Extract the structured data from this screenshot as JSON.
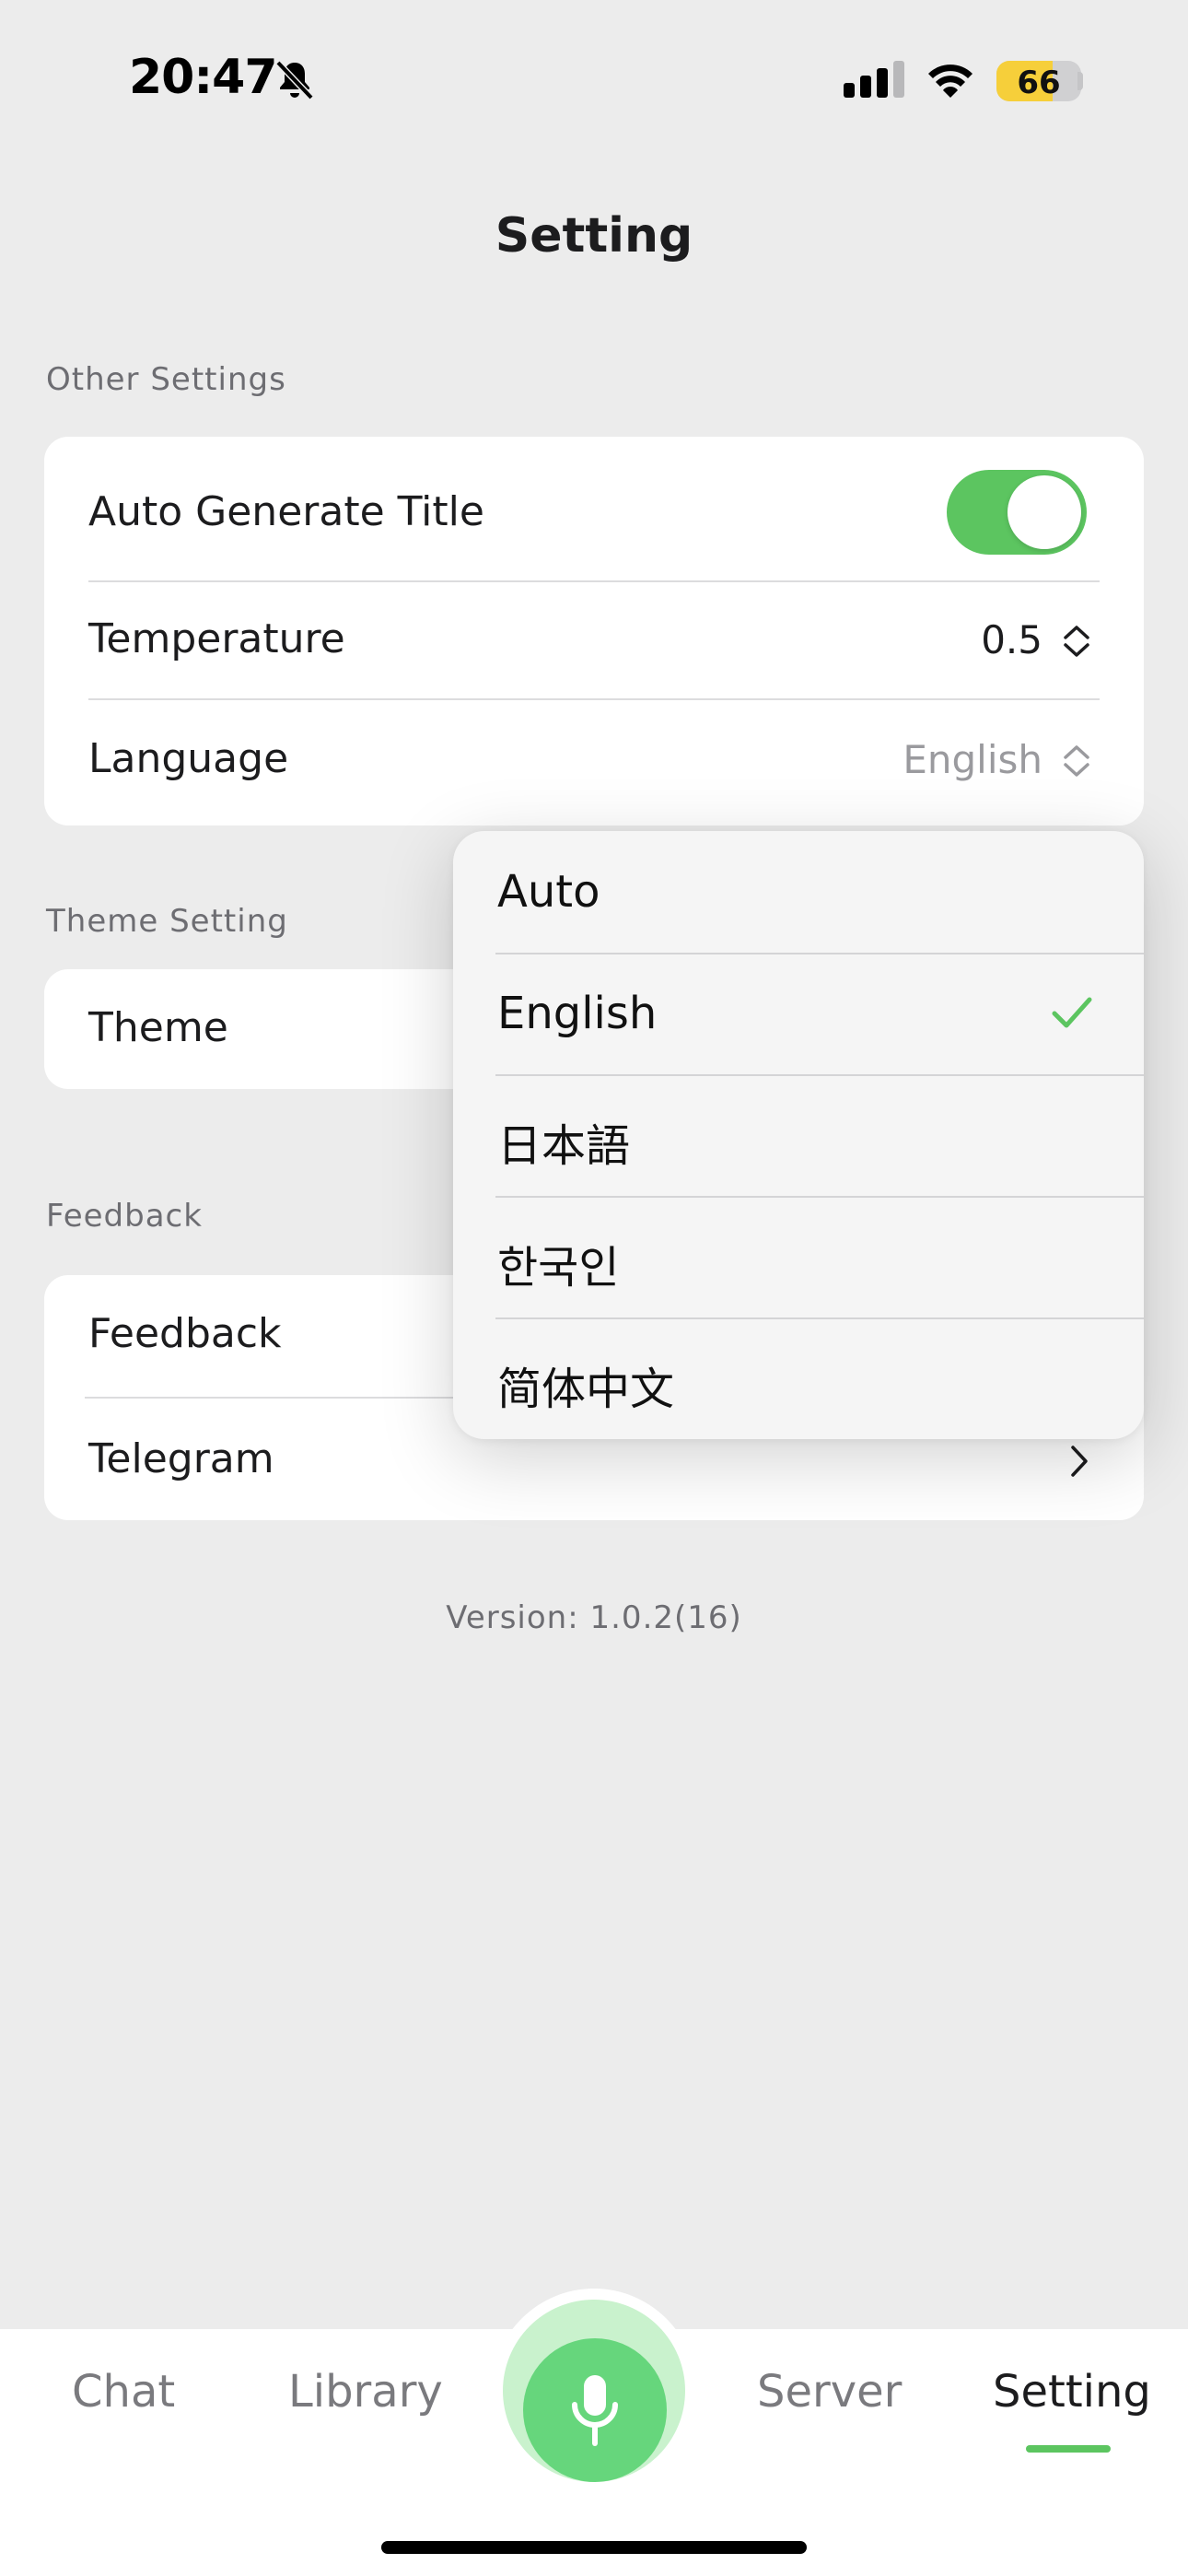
{
  "status_bar": {
    "time": "20:47",
    "battery_level": "66",
    "battery_fraction": 0.66,
    "icons": [
      "bell-slash-icon",
      "cellular-signal-icon",
      "wifi-icon",
      "battery-icon"
    ]
  },
  "nav": {
    "title": "Setting"
  },
  "sections": {
    "other": {
      "header": "Other Settings",
      "auto_title": {
        "label": "Auto Generate Title",
        "enabled": true
      },
      "temperature": {
        "label": "Temperature",
        "value": "0.5"
      },
      "language": {
        "label": "Language",
        "value": "English"
      }
    },
    "theme": {
      "header": "Theme Setting",
      "theme": {
        "label": "Theme"
      }
    },
    "feedback": {
      "header": "Feedback",
      "feedback": {
        "label": "Feedback"
      },
      "telegram": {
        "label": "Telegram"
      }
    }
  },
  "version": "Version: 1.0.2(16)",
  "language_menu": {
    "options": [
      "Auto",
      "English",
      "日本語",
      "한국인",
      "简体中文"
    ],
    "selected": "English"
  },
  "tabbar": {
    "tabs": [
      "Chat",
      "Library",
      "Server",
      "Setting"
    ],
    "active": "Setting",
    "center_icon": "microphone-icon"
  },
  "colors": {
    "accent": "#5cc560",
    "mic": "#66d67c",
    "background": "#ececec"
  }
}
